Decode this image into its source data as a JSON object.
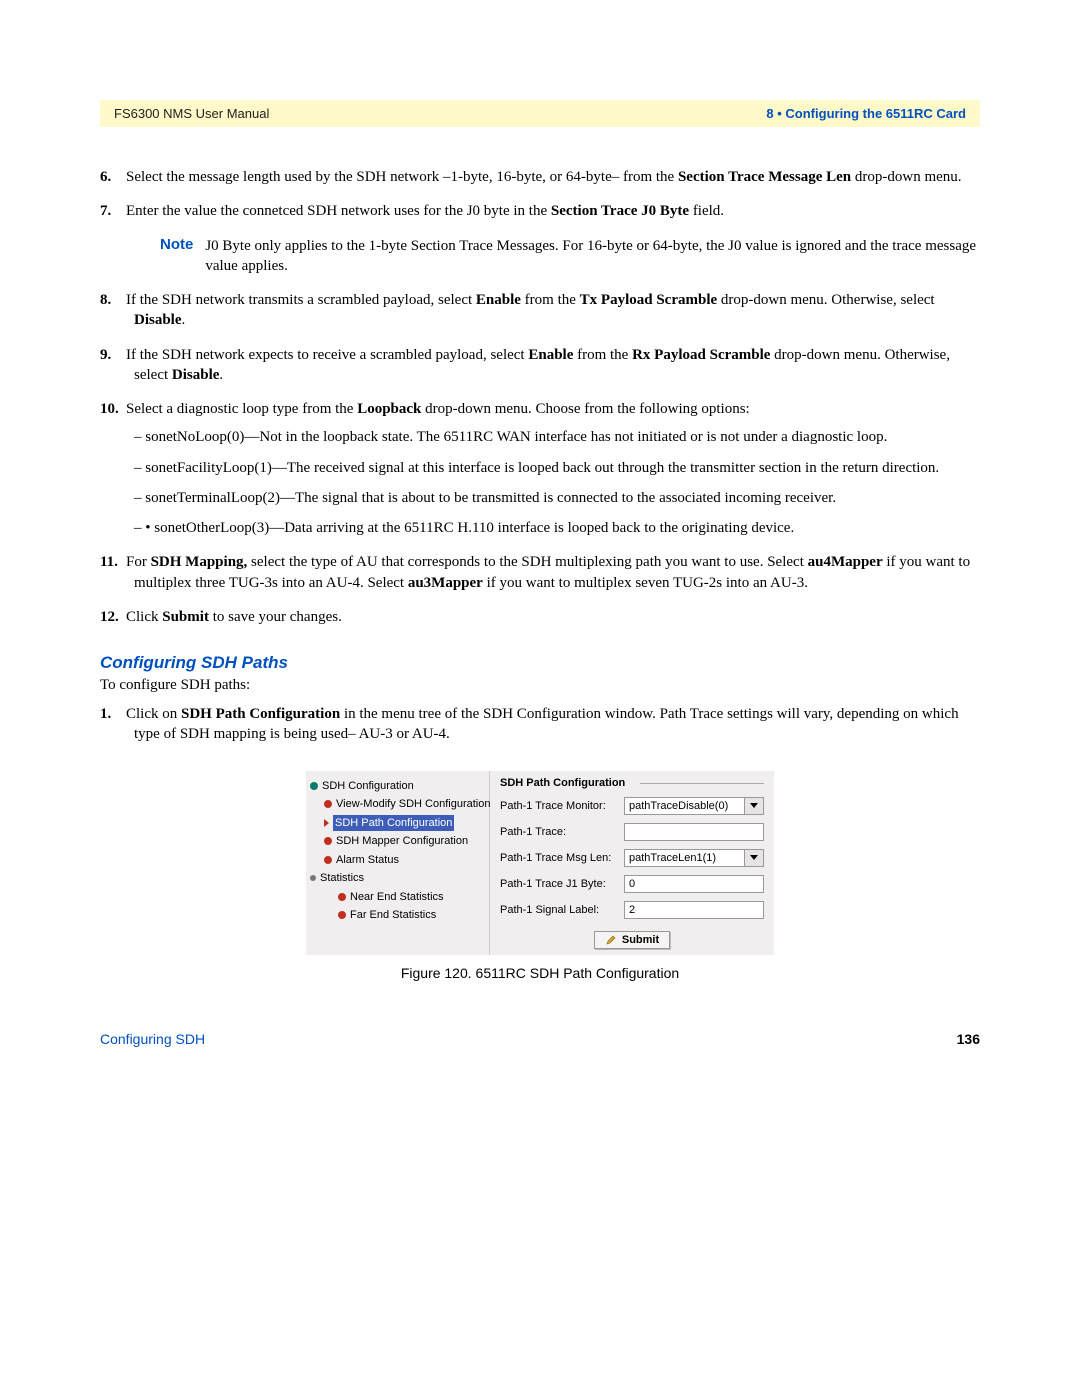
{
  "header": {
    "left": "FS6300 NMS User Manual",
    "right": "8 • Configuring the 6511RC Card"
  },
  "items": {
    "six": {
      "num": "6.",
      "t1": "Select the message length used by the SDH network –1-byte, 16-byte, or 64-byte– from the ",
      "b1": "Section Trace Message Len",
      "t2": " drop-down menu."
    },
    "seven": {
      "num": "7.",
      "t1": "Enter the value the connetced SDH network uses for the J0 byte in the ",
      "b1": "Section Trace J0 Byte",
      "t2": " field."
    },
    "eight": {
      "num": "8.",
      "t1": "If the SDH network transmits a scrambled payload, select ",
      "b1": "Enable",
      "t2": " from the ",
      "b2": "Tx Payload Scramble",
      "t3": " drop-down menu. Otherwise, select ",
      "b3": "Disable",
      "t4": "."
    },
    "nine": {
      "num": "9.",
      "t1": "If the SDH network expects to receive a scrambled payload, select ",
      "b1": "Enable",
      "t2": " from the ",
      "b2": "Rx Payload Scramble",
      "t3": " drop-down menu. Otherwise, select ",
      "b3": "Disable",
      "t4": "."
    },
    "ten": {
      "num": "10.",
      "t1": "Select a diagnostic loop type from the ",
      "b1": "Loopback",
      "t2": " drop-down menu. Choose from the following options:",
      "sub": {
        "a": "– sonetNoLoop(0)—Not in the loopback state. The 6511RC WAN interface has not initiated or is not under a diagnostic loop.",
        "b": "– sonetFacilityLoop(1)—The received signal at this interface is looped back out through the transmitter section in the return direction.",
        "c": "– sonetTerminalLoop(2)—The signal that is about to be transmitted is connected to the associated incoming receiver.",
        "d": "– • sonetOtherLoop(3)—Data arriving at the 6511RC H.110 interface is looped back to the originating device."
      }
    },
    "eleven": {
      "num": "11.",
      "t1": "For ",
      "b1": "SDH Mapping,",
      "t2": " select the type of AU that corresponds to the SDH multiplexing path you want to use. Select ",
      "b2": "au4Mapper",
      "t3": " if you want to multiplex three TUG-3s into an AU-4. Select ",
      "b3": "au3Mapper",
      "t4": " if you want to multiplex seven TUG-2s into an AU-3."
    },
    "twelve": {
      "num": "12.",
      "t1": "Click ",
      "b1": "Submit",
      "t2": " to save your changes."
    }
  },
  "note": {
    "label": "Note",
    "text": "J0 Byte only applies to the 1-byte Section Trace Messages. For 16-byte or 64-byte, the J0 value is ignored and the trace message value applies."
  },
  "section_heading": "Configuring SDH Paths",
  "intro": "To configure SDH paths:",
  "step1": {
    "num": "1.",
    "t1": "Click on ",
    "b1": "SDH Path Configuration",
    "t2": " in the menu tree of the SDH Configuration window. Path Trace settings will vary, depending on which type of SDH mapping is being used– AU-3 or AU-4."
  },
  "figure": {
    "tree": {
      "root": "SDH Configuration",
      "n1": "View-Modify SDH Configuration",
      "n2": "SDH Path Configuration",
      "n3": "SDH Mapper Configuration",
      "n4": "Alarm Status",
      "n5": "Statistics",
      "n6": "Near End Statistics",
      "n7": "Far End Statistics"
    },
    "form": {
      "title": "SDH Path Configuration",
      "rows": {
        "r1": {
          "label": "Path-1 Trace Monitor:",
          "value": "pathTraceDisable(0)"
        },
        "r2": {
          "label": "Path-1 Trace:",
          "value": ""
        },
        "r3": {
          "label": "Path-1 Trace Msg Len:",
          "value": "pathTraceLen1(1)"
        },
        "r4": {
          "label": "Path-1 Trace J1 Byte:",
          "value": "0"
        },
        "r5": {
          "label": "Path-1 Signal Label:",
          "value": "2"
        }
      },
      "submit": "Submit"
    },
    "caption": "Figure 120. 6511RC SDH Path Configuration"
  },
  "footer": {
    "left": "Configuring SDH",
    "right": "136"
  }
}
